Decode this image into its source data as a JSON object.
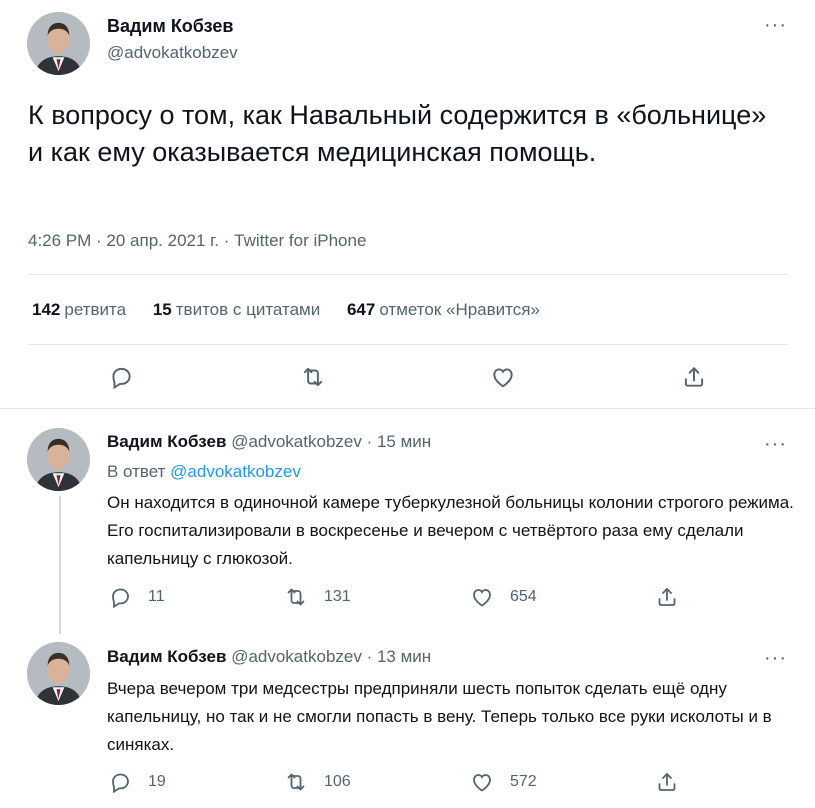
{
  "main": {
    "author_name": "Вадим Кобзев",
    "author_handle": "@advokatkobzev",
    "more": "···",
    "text": "К вопросу о том, как Навальный содержится в «больнице» и как ему оказывается медицинская помощь.",
    "time": "4:26 PM · 20 апр. 2021 г.",
    "separator": " · ",
    "source": "Twitter for iPhone",
    "stats": {
      "retweets_count": "142",
      "retweets_label": "ретвита",
      "quotes_count": "15",
      "quotes_label": "твитов с цитатами",
      "likes_count": "647",
      "likes_label": "отметок «Нравится»"
    }
  },
  "replies": [
    {
      "name": "Вадим Кобзев",
      "handle_time": "@advokatkobzev · 15 мин",
      "in_reply_prefix": "В ответ ",
      "in_reply_handle": "@advokatkobzev",
      "text": "Он находится в одиночной камере туберкулезной больницы колонии строгого режима. Его госпитализировали в воскресенье и вечером с четвёртого раза ему сделали капельницу с глюкозой.",
      "replies": "11",
      "retweets": "131",
      "likes": "654"
    },
    {
      "name": "Вадим Кобзев",
      "handle_time": "@advokatkobzev · 13 мин",
      "text": "Вчера вечером три медсестры предприняли шесть попыток сделать ещё одну капельницу, но так и не смогли попасть в вену. Теперь только все руки исколоты и в синяках.",
      "replies": "19",
      "retweets": "106",
      "likes": "572"
    }
  ],
  "colors": {
    "accent": "#1d9bf0",
    "text": "#0f1419",
    "secondary": "#536471",
    "border": "#e5e9ec"
  },
  "icons": [
    "reply-icon",
    "retweet-icon",
    "like-icon",
    "share-icon",
    "more-icon",
    "avatar"
  ]
}
